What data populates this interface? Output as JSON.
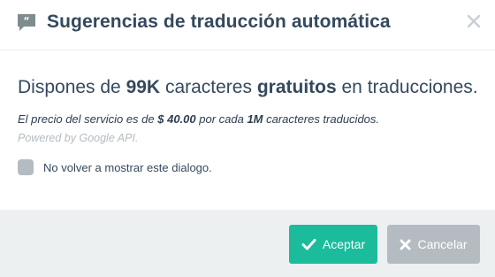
{
  "dialog": {
    "title": "Sugerencias de traducción automática",
    "headline": {
      "prefix": "Dispones de ",
      "amount": "99K",
      "middle": " caracteres ",
      "free": "gratuitos",
      "suffix": " en traducciones."
    },
    "price": {
      "prefix": "El precio del servicio es de ",
      "amount": "$ 40.00",
      "middle": " por cada ",
      "unit": "1M",
      "suffix": " caracteres traducidos."
    },
    "powered_by": "Powered by Google API.",
    "dont_show_label": "No volver a mostrar este dialogo."
  },
  "buttons": {
    "accept_label": "Aceptar",
    "cancel_label": "Cancelar"
  },
  "icons": {
    "header": "quote-bubble-icon",
    "close": "close-icon",
    "accept": "check-icon",
    "cancel": "x-icon"
  },
  "colors": {
    "text": "#34495e",
    "accent": "#1abc9c",
    "muted": "#b4bcc2",
    "footer_bg": "#ecf0f1"
  }
}
